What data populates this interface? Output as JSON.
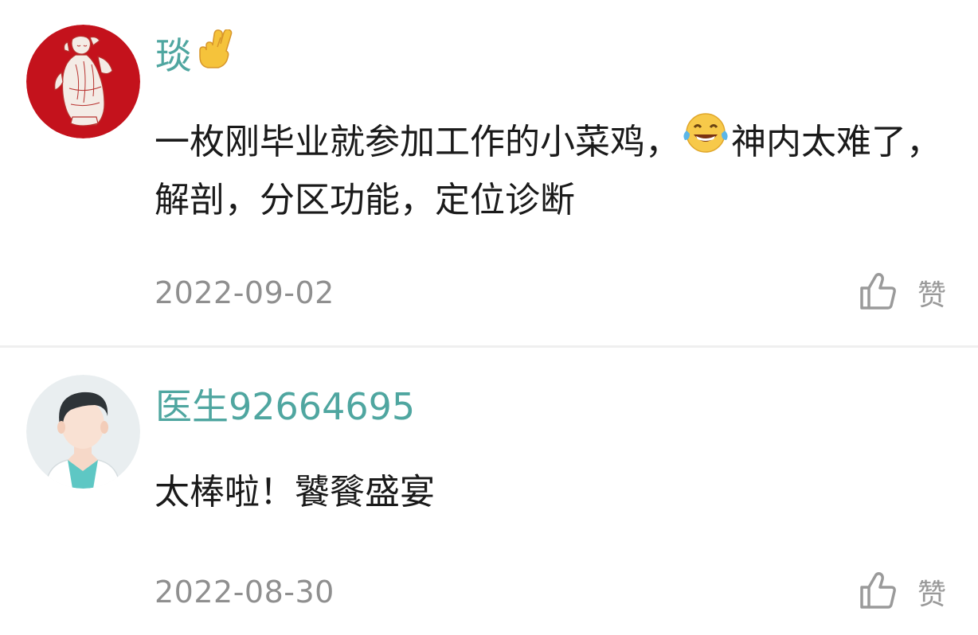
{
  "comments": [
    {
      "username": "琰",
      "username_emoji": "crossed-fingers-icon",
      "content_before": "一枚刚毕业就参加工作的小菜鸡，",
      "content_emoji": "laughing-tears-icon",
      "content_after": "神内太难了，解剖，分区功能，定位诊断",
      "date": "2022-09-02",
      "like_label": "赞",
      "avatar": "red-circle-figure-avatar"
    },
    {
      "username": "医生92664695",
      "content": "太棒啦！饕餮盛宴",
      "date": "2022-08-30",
      "like_label": "赞",
      "avatar": "doctor-avatar"
    }
  ],
  "colors": {
    "username": "#4fa6a0",
    "content": "#1a1a1a",
    "date": "#8f8f8f",
    "like": "#999999",
    "avatar_red": "#c4121c",
    "divider": "#efefef"
  }
}
